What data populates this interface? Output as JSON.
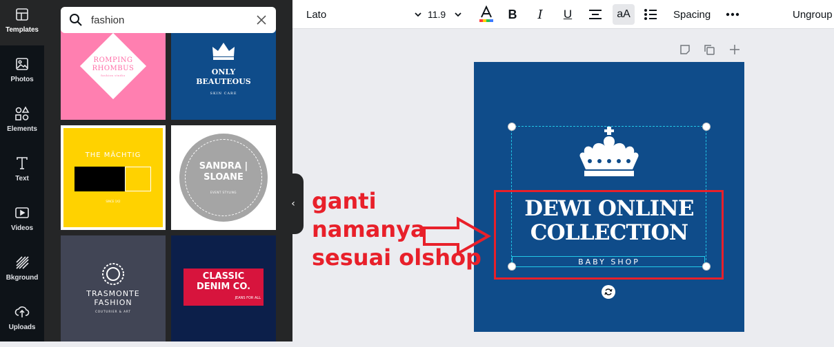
{
  "nav": {
    "items": [
      {
        "label": "Templates",
        "icon": "templates-icon"
      },
      {
        "label": "Photos",
        "icon": "photos-icon"
      },
      {
        "label": "Elements",
        "icon": "elements-icon"
      },
      {
        "label": "Text",
        "icon": "text-icon"
      },
      {
        "label": "Videos",
        "icon": "videos-icon"
      },
      {
        "label": "Bkground",
        "icon": "background-icon"
      },
      {
        "label": "Uploads",
        "icon": "uploads-icon"
      }
    ]
  },
  "search": {
    "value": "fashion"
  },
  "templates": [
    {
      "line1": "ROMPING",
      "line2": "RHOMBUS",
      "tag": "fashion studio",
      "bg": "#ff7fb0"
    },
    {
      "line1": "ONLY",
      "line2": "BEAUTEOUS",
      "tag": "SKIN CARE",
      "bg": "#0f4c8a"
    },
    {
      "line1": "THE MÄCHTIG",
      "tag": "SINCE 1X2",
      "bg": "#ffd200"
    },
    {
      "line1": "SANDRA |",
      "line2": "SLOANE",
      "tag": "EVENT STYLING",
      "bg": "#ffffff"
    },
    {
      "line1": "TRASMONTE",
      "line2": "FASHION",
      "tag": "COUTURIER & ART",
      "bg": "#414555"
    },
    {
      "line1": "CLASSIC",
      "line2": "DENIM CO.",
      "tag": "JEANS FOR ALL",
      "bg": "#0c1f4a"
    }
  ],
  "toolbar": {
    "font": "Lato",
    "size": "11.9",
    "bold": "B",
    "italic": "I",
    "underline": "U",
    "case": "aA",
    "spacing": "Spacing",
    "ungroup": "Ungroup"
  },
  "design": {
    "title_line1": "DEWI ONLINE",
    "title_line2": "COLLECTION",
    "subtitle": "BABY SHOP",
    "bg": "#0f4c8a"
  },
  "annotation": {
    "line1": "ganti",
    "line2": "namanya",
    "line3": "sesuai olshop",
    "color": "#e8202a"
  }
}
